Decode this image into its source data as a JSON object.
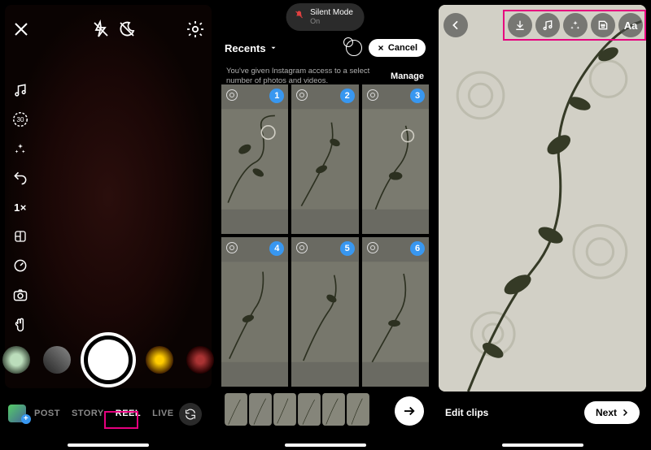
{
  "screen1": {
    "modes": {
      "post": "POST",
      "story": "STORY",
      "reel": "REEL",
      "live": "LIVE"
    },
    "zoom": "1×",
    "timer_seconds": "30"
  },
  "screen2": {
    "silent_mode_title": "Silent Mode",
    "silent_mode_sub": "On",
    "album_label": "Recents",
    "cancel": "Cancel",
    "access_msg": "You've given Instagram access to a select number of photos and videos.",
    "manage": "Manage",
    "selected": [
      "1",
      "2",
      "3",
      "4",
      "5",
      "6"
    ]
  },
  "screen3": {
    "edit_clips": "Edit clips",
    "next": "Next",
    "tools": {
      "download": "download-icon",
      "music": "music-icon",
      "effects": "sparkle-icon",
      "sticker": "sticker-icon",
      "text": "text-icon"
    },
    "text_glyph": "Aa"
  }
}
